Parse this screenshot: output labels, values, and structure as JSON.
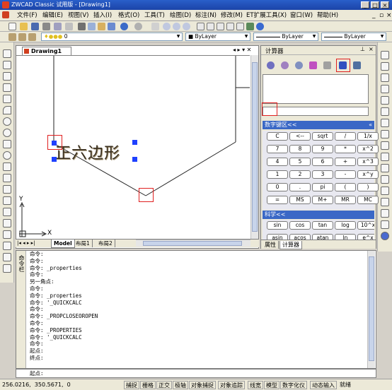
{
  "window": {
    "title": "ZWCAD Classic 试用版 - [Drawing1]"
  },
  "menus": [
    "文件(F)",
    "编辑(E)",
    "视图(V)",
    "插入(I)",
    "格式(O)",
    "工具(T)",
    "绘图(D)",
    "标注(N)",
    "修改(M)",
    "ET扩展工具(X)",
    "窗口(W)",
    "帮助(H)"
  ],
  "toolbar": {
    "layer_value": "0",
    "color_value": "■ ByLayer",
    "linetype_value": "ByLayer",
    "lineweight_value": "ByLayer"
  },
  "document": {
    "tab_label": "Drawing1",
    "text_object": "正六边形",
    "ucs_x": "X",
    "ucs_y": "Y",
    "layout_tabs": [
      "Model",
      "布局1",
      "布局2"
    ]
  },
  "calculator": {
    "title": "计算器",
    "number_pad_label": "数字键区<<",
    "number_buttons": [
      [
        "C",
        "<--",
        "sqrt",
        "/",
        "1/x"
      ],
      [
        "7",
        "8",
        "9",
        "*",
        "x^2"
      ],
      [
        "4",
        "5",
        "6",
        "+",
        "x^3"
      ],
      [
        "1",
        "2",
        "3",
        "-",
        "x^y"
      ],
      [
        "0",
        ".",
        "pi",
        "(",
        ")"
      ],
      [
        "=",
        "MS",
        "M+",
        "MR",
        "MC"
      ]
    ],
    "sci_label": "科学<<",
    "sci_buttons": [
      [
        "sin",
        "cos",
        "tan",
        "log",
        "10^x"
      ],
      [
        "asin",
        "acos",
        "atan",
        "ln",
        "e^x"
      ]
    ],
    "tabs": [
      "属性",
      "计算器"
    ]
  },
  "command": {
    "side_label": "命令栏",
    "lines": [
      "命令:",
      "命令:",
      "命令: _properties",
      "命令:",
      "另一角点:",
      "命令:",
      "命令: _properties",
      "命令: '_QUICKCALC",
      "命令:",
      "命令: _PROPCLOSEOROPEN",
      "命令:",
      "命令: _PROPERTIES",
      "命令: '_QUICKCALC",
      "命令:",
      "起点:",
      "终点:"
    ],
    "prompt": "起点:"
  },
  "status": {
    "coords": "256.0216,  350.5671,  0",
    "buttons": [
      "捕捉",
      "栅格",
      "正交",
      "极轴",
      "对象捕捉",
      "对象追踪",
      "线宽",
      "模型",
      "数字化仪",
      "动态输入",
      "就绪"
    ]
  }
}
